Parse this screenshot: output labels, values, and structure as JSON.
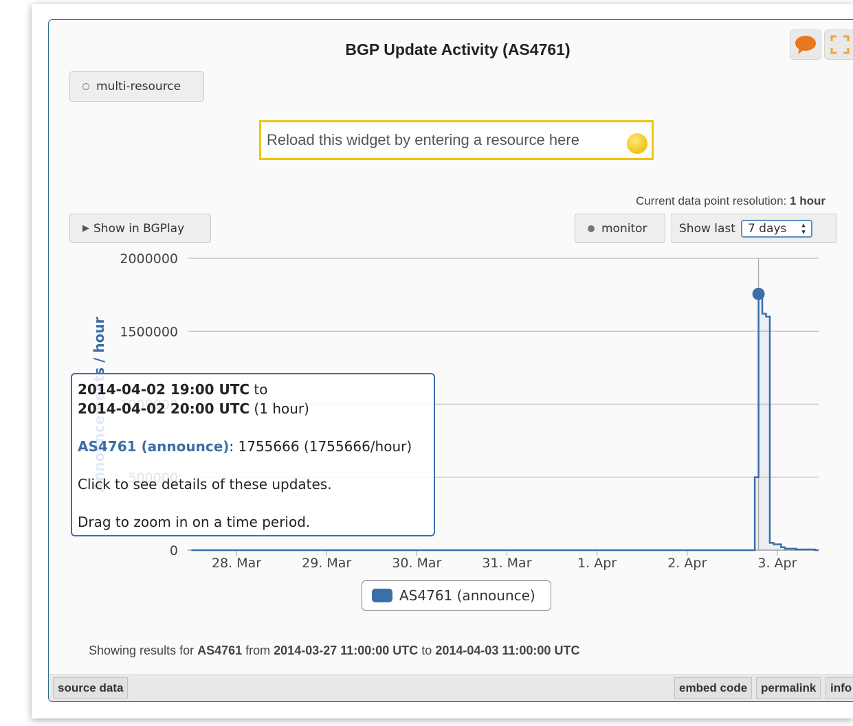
{
  "widget": {
    "title": "BGP Update Activity (AS4761)",
    "multi_resource_label": "multi-resource",
    "reload_text": "Reload this widget by entering a resource here",
    "resolution_prefix": "Current data point resolution: ",
    "resolution_value": "1 hour",
    "show_bgplay_label": "Show in BGPlay",
    "monitor_label": "monitor",
    "show_last_label": "Show last",
    "show_last_selected": "7 days",
    "accent_color": "#3c6ea8",
    "frame_color": "#2f6f86",
    "icons": [
      "speech-bubble-icon",
      "fullscreen-icon",
      "play-triangle-icon",
      "circle-dot-icon",
      "select-arrows-icon"
    ]
  },
  "chart_data": {
    "type": "line",
    "ylabel": "Announcements / hour",
    "yticks": [
      "0",
      "500000",
      "1000000",
      "1500000",
      "2000000"
    ],
    "ylim": [
      0,
      2000000
    ],
    "xticks": [
      "28. Mar",
      "29. Mar",
      "30. Mar",
      "31. Mar",
      "1. Apr",
      "2. Apr",
      "3. Apr"
    ],
    "x_range": [
      "2014-03-27 11:00 UTC",
      "2014-04-03 11:00 UTC"
    ],
    "grid": true,
    "series": [
      {
        "name": "AS4761 (announce)",
        "color": "#3c6ea8",
        "x": [
          "2014-03-27 12:00",
          "2014-04-02 17:00",
          "2014-04-02 18:00",
          "2014-04-02 19:00",
          "2014-04-02 20:00",
          "2014-04-02 21:00",
          "2014-04-02 22:00",
          "2014-04-02 23:00",
          "2014-04-03 00:00",
          "2014-04-03 01:00",
          "2014-04-03 02:00",
          "2014-04-03 03:00",
          "2014-04-03 05:00",
          "2014-04-03 08:00",
          "2014-04-03 10:00"
        ],
        "y": [
          0,
          0,
          500000,
          1755666,
          1620000,
          1600000,
          50000,
          40000,
          40000,
          20000,
          10000,
          10000,
          5000,
          5000,
          0
        ]
      }
    ],
    "legend": "bottom-center",
    "highlight": {
      "x": "2014-04-02 19:00",
      "y": 1755666
    }
  },
  "tooltip": {
    "line1_bold": "2014-04-02 19:00 UTC",
    "line1_rest": " to",
    "line2_bold": "2014-04-02 20:00 UTC",
    "line2_rest": " (1 hour)",
    "series_label": "AS4761 (announce)",
    "series_value": ": 1755666 (1755666/hour)",
    "click_hint": "Click to see details of these updates.",
    "drag_hint": "Drag to zoom in on a time period."
  },
  "summary": {
    "prefix": "Showing results for ",
    "resource": "AS4761",
    "from_word": " from ",
    "start": "2014-03-27 11:00:00 UTC",
    "to_word": " to ",
    "end": "2014-04-03 11:00:00 UTC"
  },
  "footer": {
    "source_data": "source data",
    "embed_code": "embed code",
    "permalink": "permalink",
    "info": "info"
  }
}
